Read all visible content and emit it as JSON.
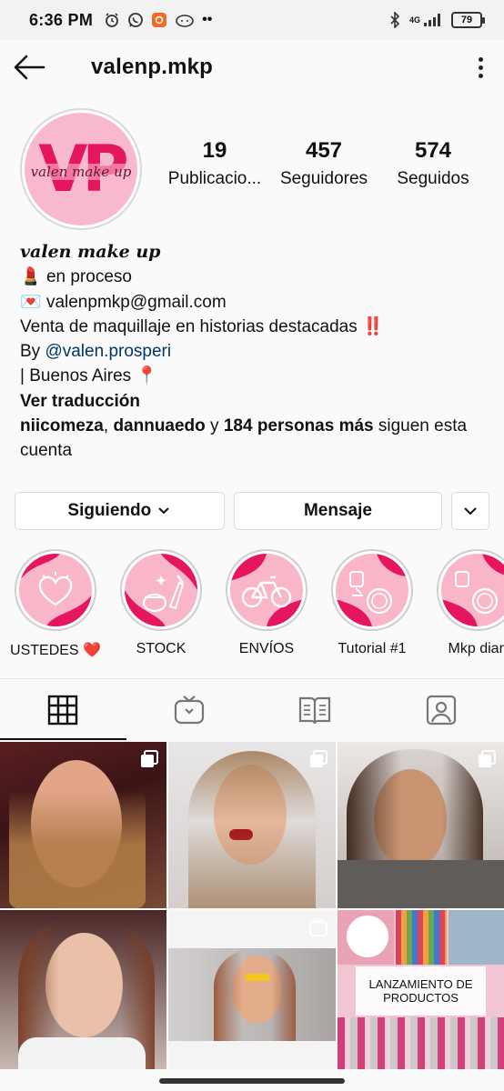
{
  "status_bar": {
    "time": "6:36 PM",
    "network": "4G",
    "battery": "79"
  },
  "header": {
    "username": "valenp.mkp",
    "back_icon": "arrow-left-icon",
    "more_icon": "more-vertical-icon"
  },
  "profile": {
    "avatar_logo_text": "VP",
    "avatar_logo_subtitle": "valen make up",
    "stats": [
      {
        "value": "19",
        "label": "Publicacio..."
      },
      {
        "value": "457",
        "label": "Seguidores"
      },
      {
        "value": "574",
        "label": "Seguidos"
      }
    ]
  },
  "bio": {
    "name": "valen make up",
    "line1_emoji": "💄",
    "line1_text": " en proceso",
    "line2_emoji": "💌",
    "line2_text": " valenpmkp@gmail.com",
    "line3_text": "Venta de maquillaje en historias destacadas ",
    "line3_emoji": "‼️",
    "line4_prefix": "By ",
    "line4_link": "@valen.prosperi",
    "line5_text": "| Buenos Aires ",
    "line5_emoji": "📍",
    "translate": "Ver traducción",
    "followed_by_user1": "niicomeza",
    "followed_by_sep": ", ",
    "followed_by_user2": "dannuaedo",
    "followed_by_and": " y ",
    "followed_by_count": "184 personas más",
    "followed_by_suffix": " siguen esta cuenta"
  },
  "actions": {
    "following": "Siguiendo",
    "message": "Mensaje"
  },
  "highlights": [
    {
      "label": "USTEDES ❤️",
      "icon": "heart-icon"
    },
    {
      "label": "STOCK",
      "icon": "makeup-icon"
    },
    {
      "label": "ENVÍOS",
      "icon": "bicycle-icon"
    },
    {
      "label": "Tutorial #1",
      "icon": "mirror-icon"
    },
    {
      "label": "Mkp diari",
      "icon": "mirror-icon"
    }
  ],
  "tabs": [
    {
      "name": "grid",
      "icon": "grid-icon"
    },
    {
      "name": "igtv",
      "icon": "igtv-icon"
    },
    {
      "name": "guides",
      "icon": "guide-icon"
    },
    {
      "name": "tagged",
      "icon": "tagged-icon"
    }
  ],
  "posts": {
    "overlay_text": "LANZAMIENTO DE PRODUCTOS"
  },
  "colors": {
    "brand_pink": "#e6155f",
    "light_pink": "#f8b6c8",
    "link": "#00376b"
  }
}
